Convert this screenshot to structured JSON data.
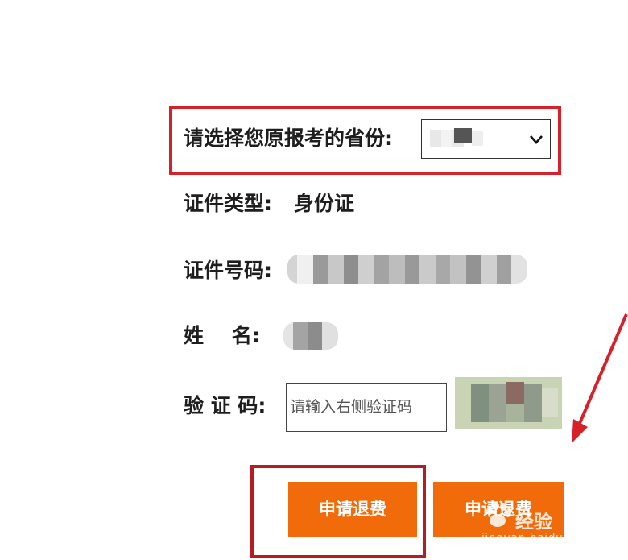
{
  "province": {
    "label": "请选择您原报考的省份:"
  },
  "id_type": {
    "label": "证件类型:",
    "value": "身份证"
  },
  "id_number": {
    "label": "证件号码:"
  },
  "name": {
    "label": "姓    名:"
  },
  "captcha": {
    "label": "验 证 码:",
    "placeholder": "请输入右侧验证码"
  },
  "buttons": {
    "apply_refund_1": "申请退费",
    "apply_refund_2": "申请退费"
  },
  "watermark": {
    "logo_text": "经验",
    "url": "jingyan.baidu.com"
  },
  "colors": {
    "accent": "#f26b0a",
    "highlight": "#d6202a"
  }
}
